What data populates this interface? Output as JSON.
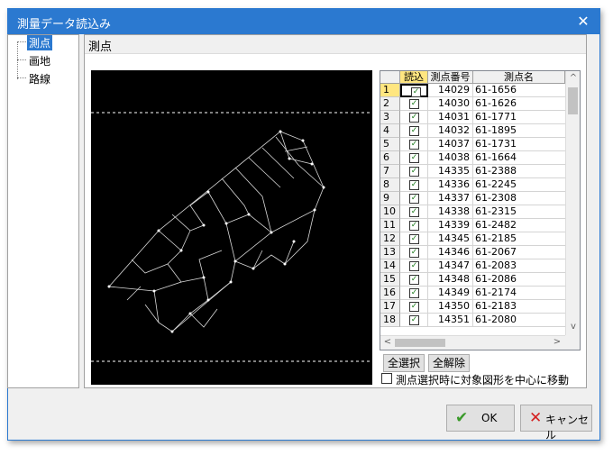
{
  "window": {
    "title": "測量データ読込み",
    "close_glyph": "✕"
  },
  "tree": {
    "items": [
      "測点",
      "画地",
      "路線"
    ],
    "selected": "測点"
  },
  "panel": {
    "title": "測点"
  },
  "grid": {
    "headers": {
      "read": "読込",
      "number": "測点番号",
      "name": "測点名"
    },
    "rows": [
      {
        "n": "1",
        "num": "14029",
        "name": "61-1656"
      },
      {
        "n": "2",
        "num": "14030",
        "name": "61-1626"
      },
      {
        "n": "3",
        "num": "14031",
        "name": "61-1771"
      },
      {
        "n": "4",
        "num": "14032",
        "name": "61-1895"
      },
      {
        "n": "5",
        "num": "14037",
        "name": "61-1731"
      },
      {
        "n": "6",
        "num": "14038",
        "name": "61-1664"
      },
      {
        "n": "7",
        "num": "14335",
        "name": "61-2388"
      },
      {
        "n": "8",
        "num": "14336",
        "name": "61-2245"
      },
      {
        "n": "9",
        "num": "14337",
        "name": "61-2308"
      },
      {
        "n": "10",
        "num": "14338",
        "name": "61-2315"
      },
      {
        "n": "11",
        "num": "14339",
        "name": "61-2482"
      },
      {
        "n": "12",
        "num": "14345",
        "name": "61-2185"
      },
      {
        "n": "13",
        "num": "14346",
        "name": "61-2067"
      },
      {
        "n": "14",
        "num": "14347",
        "name": "61-2083"
      },
      {
        "n": "15",
        "num": "14348",
        "name": "61-2086"
      },
      {
        "n": "16",
        "num": "14349",
        "name": "61-2174"
      },
      {
        "n": "17",
        "num": "14350",
        "name": "61-2183"
      },
      {
        "n": "18",
        "num": "14351",
        "name": "61-2080"
      }
    ],
    "check_glyph": "✓",
    "scroll_up": "^",
    "scroll_down": "v",
    "scroll_left": "<",
    "scroll_right": ">"
  },
  "buttons": {
    "select_all": "全選択",
    "deselect_all": "全解除",
    "ok": "OK",
    "cancel": "キャンセル"
  },
  "option": {
    "center_label": "測点選択時に対象図形を中心に移動",
    "checked": false
  },
  "icons": {
    "ok": "check-icon",
    "cancel": "cross-icon"
  },
  "colors": {
    "title_bar": "#2b79d0",
    "ok_icon": "#3a9a2a",
    "cancel_icon": "#d42020",
    "current_row": "#ffe680"
  }
}
